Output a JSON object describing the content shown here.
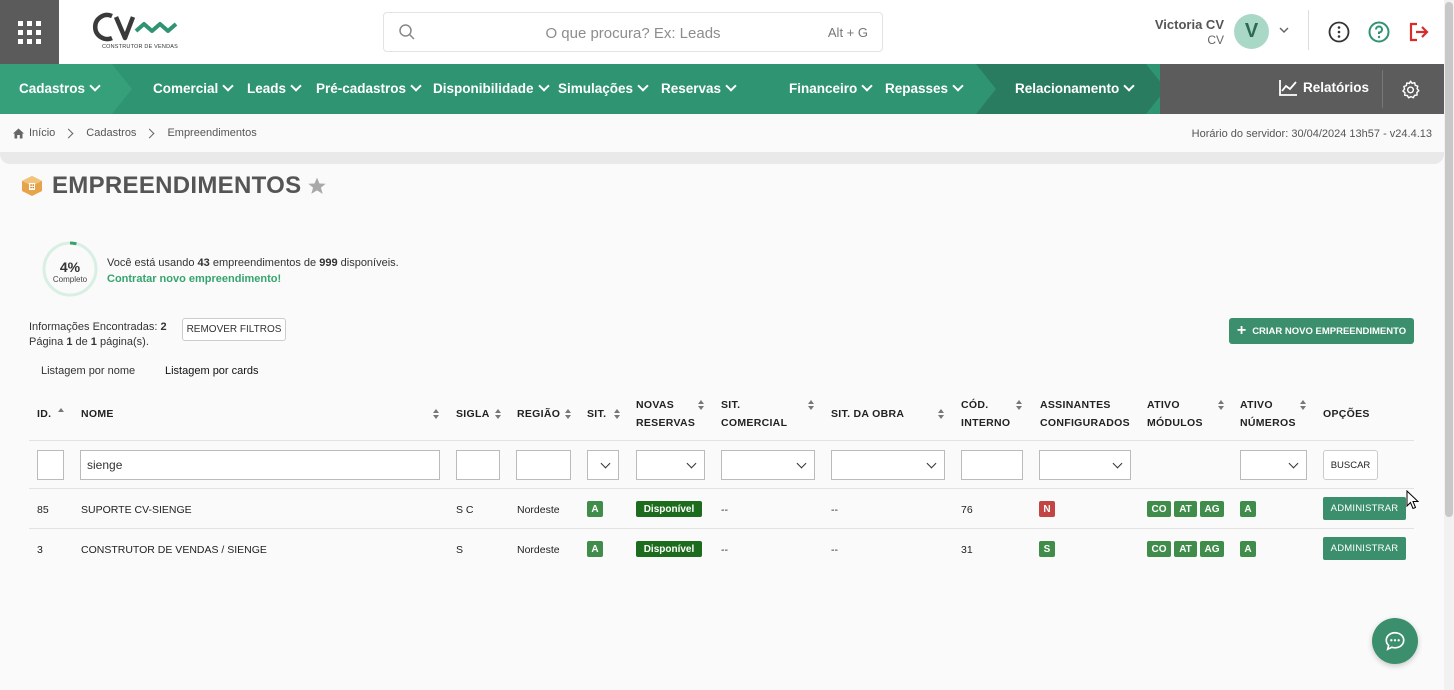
{
  "header": {
    "logo_sub": "CONSTRUTOR DE VENDAS",
    "search_placeholder": "O que procura? Ex: Leads",
    "search_shortcut": "Alt + G",
    "user_name": "Victoria CV",
    "user_sub": "CV",
    "avatar_letter": "V"
  },
  "nav": {
    "items": [
      {
        "label": "Cadastros"
      },
      {
        "label": "Comercial"
      },
      {
        "label": "Leads"
      },
      {
        "label": "Pré-cadastros"
      },
      {
        "label": "Disponibilidade"
      },
      {
        "label": "Simulações"
      },
      {
        "label": "Reservas"
      },
      {
        "label": "Financeiro"
      },
      {
        "label": "Repasses"
      },
      {
        "label": "Relacionamento"
      }
    ],
    "reports": "Relatórios"
  },
  "breadcrumb": {
    "home": "Início",
    "level1": "Cadastros",
    "level2": "Empreendimentos",
    "server_time": "Horário do servidor: 30/04/2024 13h57 - v24.4.13"
  },
  "page": {
    "title": "EMPREENDIMENTOS"
  },
  "usage": {
    "percent": 4,
    "percent_label": "4%",
    "sub": "Completo",
    "text_prefix": "Você está usando ",
    "used": "43",
    "text_mid": " empreendimentos de ",
    "total": "999",
    "text_suffix": " disponíveis.",
    "link": "Contratar novo empreendimento!"
  },
  "results": {
    "found_label": "Informações Encontradas: ",
    "found_count": "2",
    "page_prefix": "Página ",
    "page_current": "1",
    "page_mid": " de ",
    "page_total": "1",
    "page_suffix": " página(s).",
    "remove_filters": "REMOVER FILTROS",
    "create_new": "CRIAR NOVO EMPREENDIMENTO"
  },
  "views": {
    "by_name": "Listagem por nome",
    "by_cards": "Listagem por cards"
  },
  "table": {
    "headers": {
      "id": "ID.",
      "name": "NOME",
      "sigla": "SIGLA",
      "regiao": "REGIÃO",
      "sit": "SIT.",
      "novas1": "NOVAS",
      "novas2": "RESERVAS",
      "sitcom1": "SIT.",
      "sitcom2": "COMERCIAL",
      "sitobra": "SIT. DA OBRA",
      "cod1": "CÓD.",
      "cod2": "INTERNO",
      "assin1": "ASSINANTES",
      "assin2": "CONFIGURADOS",
      "mod1": "ATIVO",
      "mod2": "MÓDULOS",
      "num1": "ATIVO",
      "num2": "NÚMEROS",
      "opcoes": "OPÇÕES"
    },
    "filters": {
      "name_value": "sienge",
      "search_button": "BUSCAR"
    },
    "rows": [
      {
        "id": "85",
        "name": "SUPORTE CV-SIENGE",
        "sigla": "S C",
        "regiao": "Nordeste",
        "sit": "A",
        "novas": "Disponível",
        "sit_comercial": "--",
        "sit_obra": "--",
        "cod": "76",
        "assinantes": "N",
        "modulos": [
          "CO",
          "AT",
          "AG"
        ],
        "numeros": "A",
        "action": "ADMINISTRAR"
      },
      {
        "id": "3",
        "name": "CONSTRUTOR DE VENDAS / SIENGE",
        "sigla": "S",
        "regiao": "Nordeste",
        "sit": "A",
        "novas": "Disponível",
        "sit_comercial": "--",
        "sit_obra": "--",
        "cod": "31",
        "assinantes": "S",
        "modulos": [
          "CO",
          "AT",
          "AG"
        ],
        "numeros": "A",
        "action": "ADMINISTRAR"
      }
    ]
  },
  "colors": {
    "nav_green": "#2f9472",
    "accent": "#3b8f6d",
    "badge_green": "#3f8c4b",
    "badge_red": "#c24443"
  },
  "icons": [
    "apps-grid-icon",
    "search-icon",
    "chevron-down-icon",
    "info-icon",
    "help-icon",
    "logout-icon",
    "chart-icon",
    "gear-icon",
    "home-icon",
    "building-icon",
    "star-icon",
    "plus-icon",
    "chat-icon"
  ]
}
